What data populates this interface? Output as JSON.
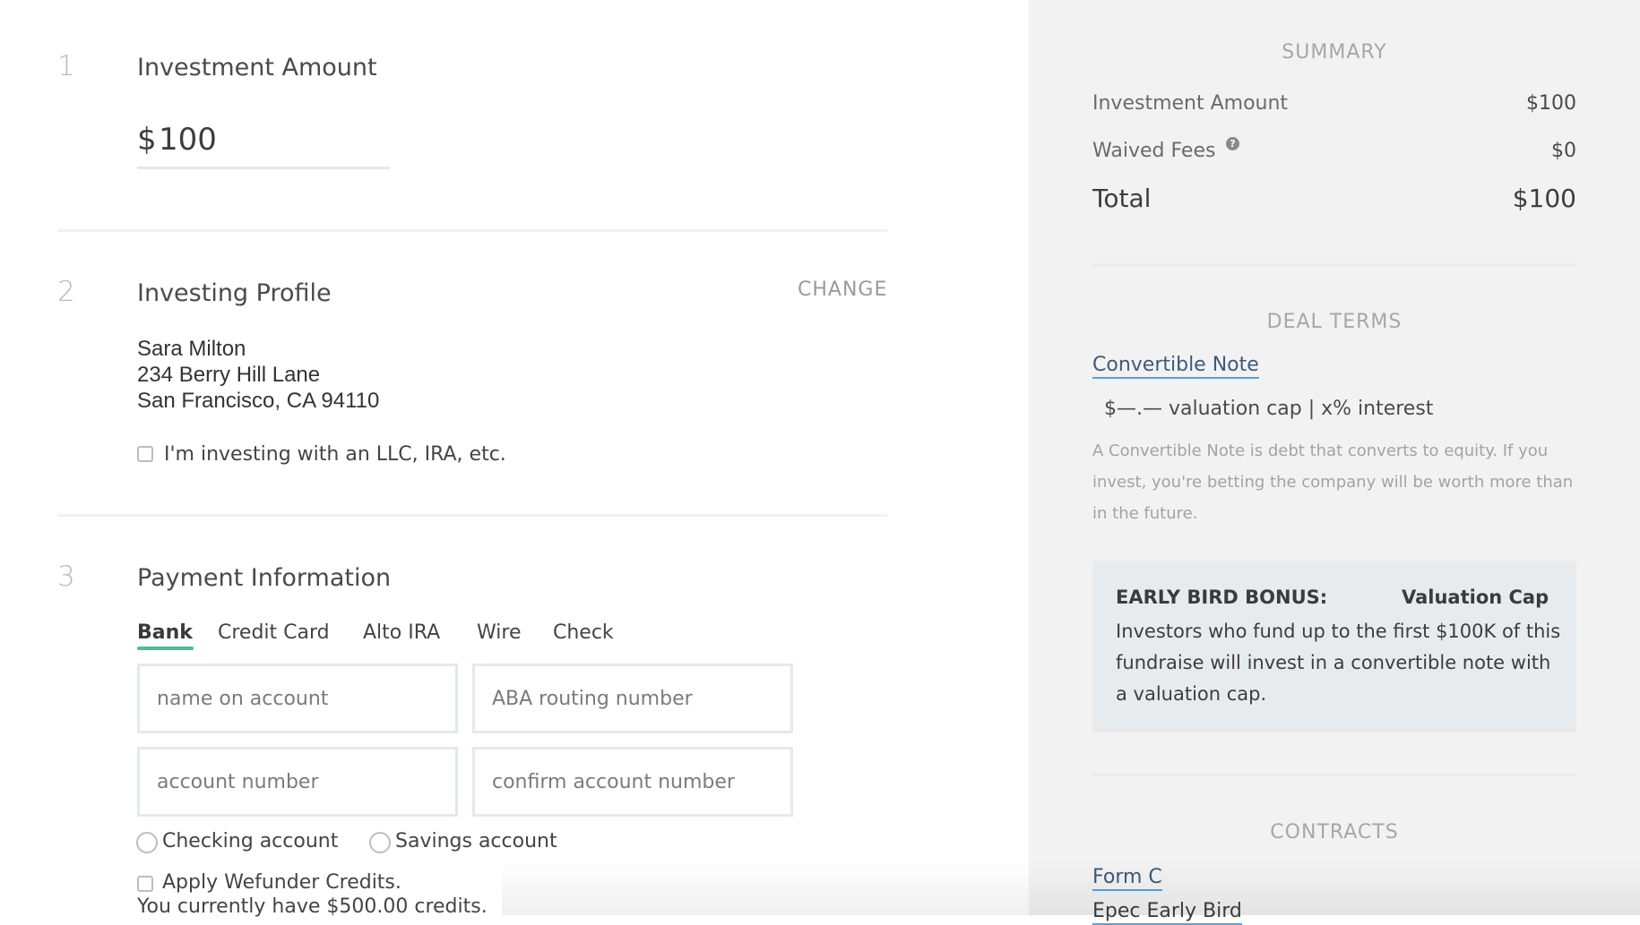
{
  "steps": {
    "one": {
      "number": "1",
      "title": "Investment Amount",
      "currency_symbol": "$",
      "amount": "100"
    },
    "two": {
      "number": "2",
      "title": "Investing Profile",
      "change_label": "CHANGE",
      "name": "Sara Milton",
      "address_line1": "234 Berry Hill Lane",
      "address_line2": "San Francisco, CA 94110",
      "entity_checkbox_label": "I'm investing with an LLC, IRA, etc."
    },
    "three": {
      "number": "3",
      "title": "Payment Information",
      "tabs": [
        {
          "label": "Bank",
          "active": true
        },
        {
          "label": "Credit Card",
          "active": false
        },
        {
          "label": "Alto IRA",
          "active": false
        },
        {
          "label": "Wire",
          "active": false
        },
        {
          "label": "Check",
          "active": false
        }
      ],
      "fields": {
        "name_on_account_placeholder": "name on account",
        "aba_routing_placeholder": "ABA routing number",
        "account_number_placeholder": "account number",
        "confirm_account_placeholder": "confirm account number"
      },
      "checking_label": "Checking account",
      "savings_label": "Savings account",
      "credits_label": "Apply Wefunder Credits.",
      "credits_note": "You currently have $500.00 credits."
    }
  },
  "summary": {
    "heading": "SUMMARY",
    "investment_amount_label": "Investment Amount",
    "investment_amount_value": "$100",
    "waived_fees_label": "Waived Fees",
    "waived_fees_value": "$0",
    "help_icon_glyph": "?",
    "total_label": "Total",
    "total_value": "$100"
  },
  "deal_terms": {
    "heading": "DEAL TERMS",
    "instrument_link": "Convertible Note",
    "terms_line": "$—.— valuation cap |  x% interest",
    "description": "A Convertible Note is debt that converts to equity. If you invest, you're betting the company will be worth more than            in the future.",
    "bonus_title": "EARLY BIRD BONUS:",
    "bonus_cap_label": "Valuation Cap",
    "bonus_body": "Investors who fund up to the first $100K of this fundraise will invest in a convertible note with a            valuation cap."
  },
  "contracts": {
    "heading": "CONTRACTS",
    "links": [
      "Form C",
      "Epec Early Bird"
    ]
  },
  "colors": {
    "accent_green": "#43c38d",
    "link_underline": "#5aa0d8",
    "panel_bg": "#f2f2f2"
  }
}
